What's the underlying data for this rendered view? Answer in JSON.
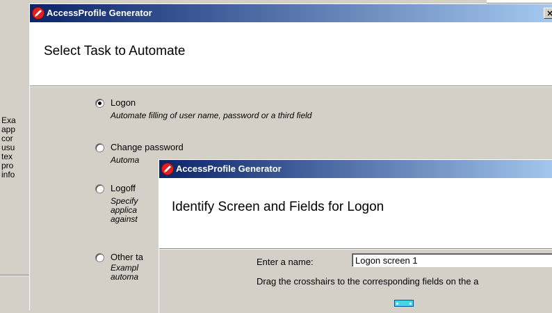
{
  "background": {
    "text_lines": [
      "Exa",
      "app",
      "cor",
      "usu",
      "tex",
      "pro",
      "info"
    ]
  },
  "dialog1": {
    "title": "AccessProfile Generator",
    "close_label": "×",
    "heading": "Select Task to Automate",
    "options": [
      {
        "label": "Logon",
        "checked": true,
        "description": [
          "Automate filling of user name, password or a third field"
        ]
      },
      {
        "label": "Change password",
        "checked": false,
        "description": [
          "Automa"
        ]
      },
      {
        "label": "Logoff",
        "checked": false,
        "description": [
          "Specify",
          "applica",
          "against"
        ]
      },
      {
        "label": "Other ta",
        "checked": false,
        "description": [
          "Exampl",
          "automa"
        ]
      }
    ]
  },
  "dialog2": {
    "title": "AccessProfile Generator",
    "heading": "Identify Screen and Fields for Logon",
    "name_label": "Enter a name:",
    "name_value": "Logon screen 1",
    "instructions": "Drag the crosshairs to the corresponding fields on the a"
  },
  "colors": {
    "title_gradient_start": "#0a246a",
    "title_gradient_end": "#a6caf0",
    "dialog_face": "#d4d0c8",
    "crosshair": "#3fd8e8"
  },
  "icons": {
    "app": "pencil-icon",
    "close": "close-icon",
    "crosshair": "crosshair-icon"
  }
}
